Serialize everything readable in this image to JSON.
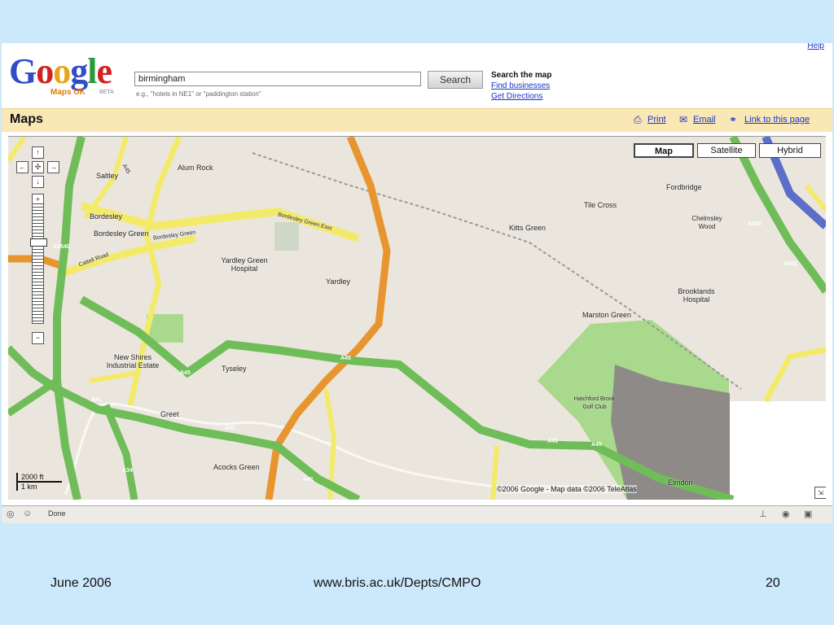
{
  "logo": {
    "brand_parts": [
      "G",
      "o",
      "o",
      "g",
      "l",
      "e"
    ],
    "subtitle": "Maps UK",
    "beta": "BETA"
  },
  "search": {
    "value": "birmingham",
    "hint": "e.g., \"hotels in NE1\" or \"paddington station\"",
    "button_label": "Search"
  },
  "search_links": {
    "title": "Search the map",
    "find_businesses": "Find businesses",
    "get_directions": "Get Directions"
  },
  "help_label": "Help",
  "maps_bar": {
    "title": "Maps",
    "print": "Print",
    "email": "Email",
    "link": "Link to this page"
  },
  "map_types": [
    "Map",
    "Satellite",
    "Hybrid"
  ],
  "map_type_selected": "Map",
  "zoom": {
    "in": "+",
    "out": "−"
  },
  "pan": {
    "up": "↑",
    "down": "↓",
    "left": "←",
    "right": "→",
    "center": "✣"
  },
  "places": [
    "Alum Rock",
    "Saltley",
    "Bordesley",
    "Bordesley Green",
    "Yardley Green Hospital",
    "Yardley",
    "Tile Cross",
    "Kitts Green",
    "Fordbridge",
    "Chelmsley Wood",
    "Brooklands Hospital",
    "Marston Green",
    "New Shires Industrial Estate",
    "Tyseley",
    "Greet",
    "Acocks Green",
    "Elmdon",
    "Hatchford Brook Golf Club"
  ],
  "roads": [
    "Bordesley Green",
    "Bordesley Green East",
    "Cattell Road",
    "A45",
    "A41",
    "A4540",
    "A452",
    "A34"
  ],
  "scale": {
    "feet": "2000 ft",
    "km": "1 km"
  },
  "copyright": "©2006 Google - Map data ©2006 TeleAtlas",
  "status": {
    "text": "Done"
  },
  "footer": {
    "date": "June 2006",
    "url": "www.bris.ac.uk/Depts/CMPO",
    "page": "20"
  },
  "colors": {
    "slide_bg": "#cce8fb",
    "motorway_green": "#6fbd58",
    "road_orange": "#e8952f",
    "road_yellow": "#f4ea6a",
    "link_blue": "#1a33c8"
  }
}
